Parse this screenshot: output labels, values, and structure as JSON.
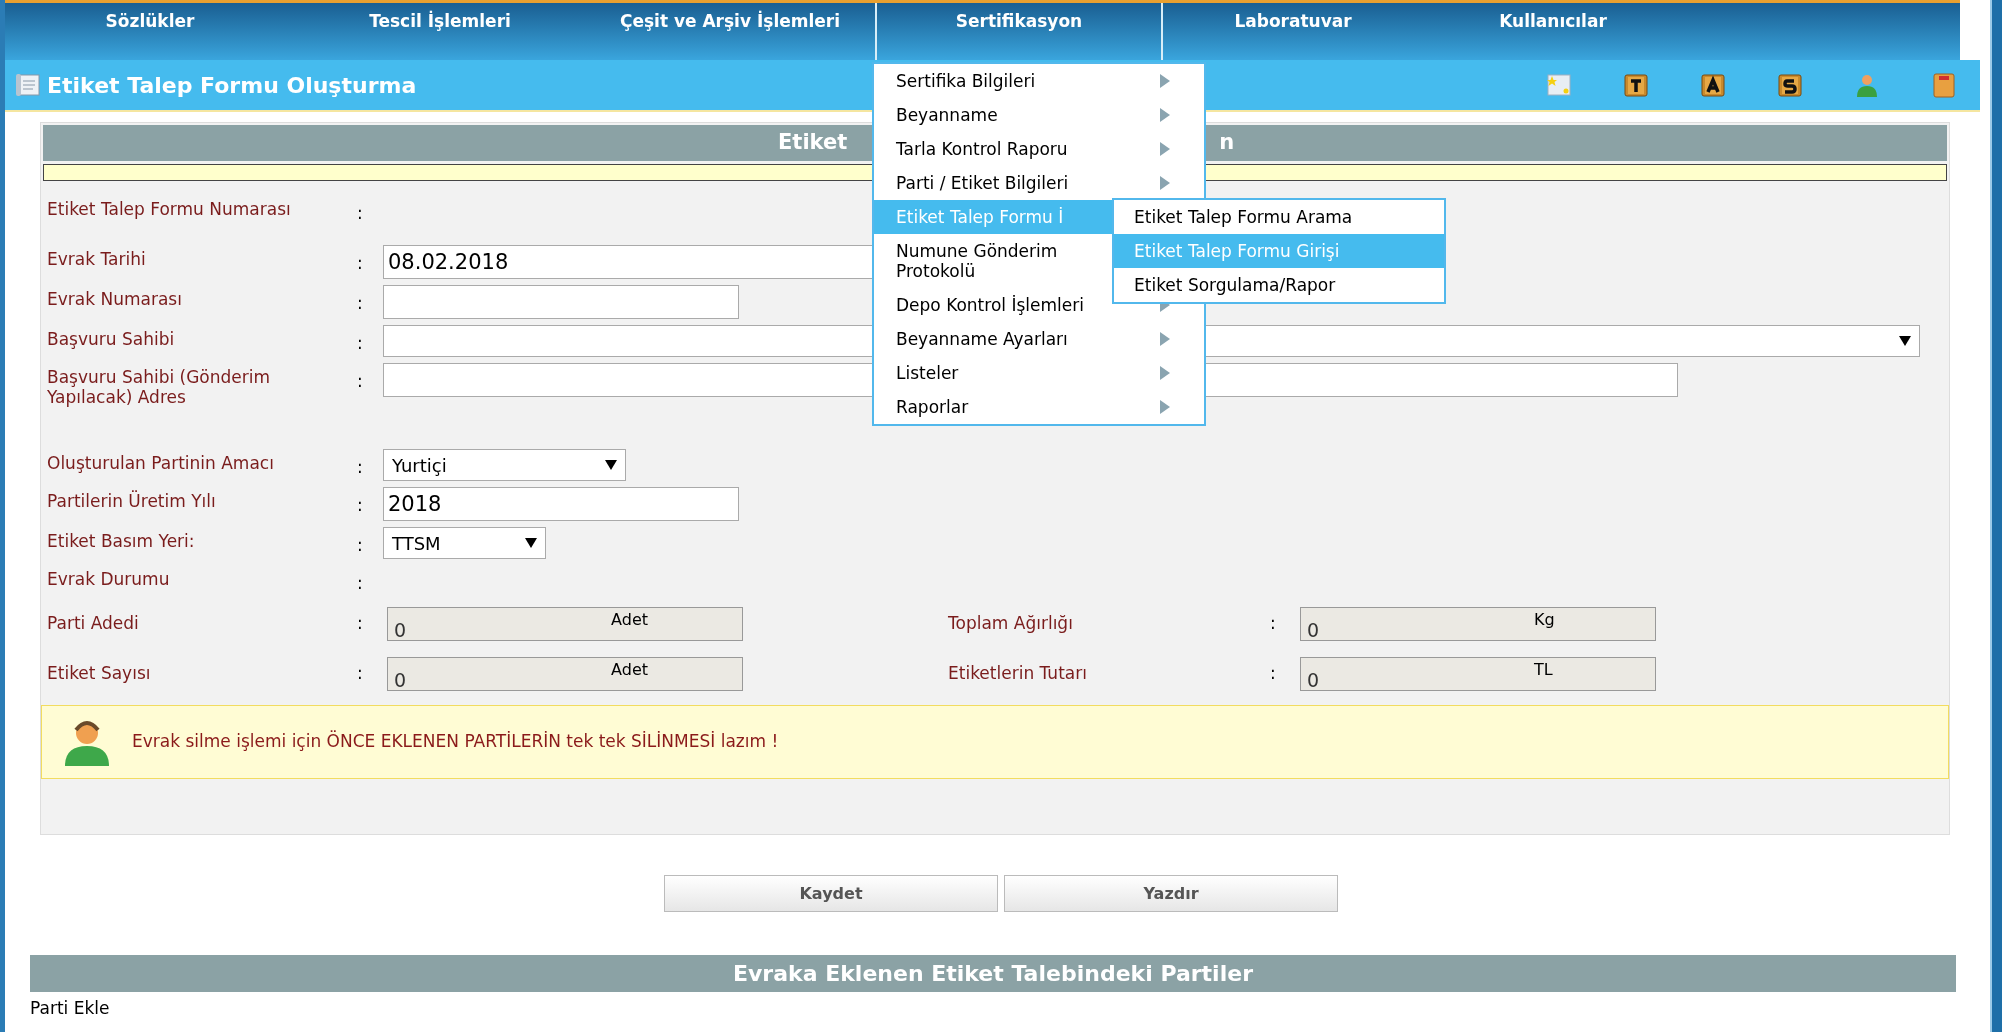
{
  "nav": [
    {
      "label": "Sözlükler",
      "selected": false
    },
    {
      "label": "Tescil İşlemleri",
      "selected": false
    },
    {
      "label": "Çeşit ve Arşiv İşlemleri",
      "selected": false
    },
    {
      "label": "Sertifikasyon",
      "selected": true
    },
    {
      "label": "Laboratuvar",
      "selected": false
    },
    {
      "label": "Kullanıcılar",
      "selected": false
    }
  ],
  "page_title": "Etiket Talep Formu Oluşturma",
  "form": {
    "header_parts": [
      "Etiket",
      "n"
    ],
    "rows": [
      {
        "kind": "none",
        "label": "Etiket Talep Formu Numarası",
        "separator": ":"
      },
      {
        "kind": "input",
        "label": "Evrak Tarihi",
        "separator": ":",
        "value": "08.02.2018"
      },
      {
        "kind": "input",
        "label": "Evrak Numarası",
        "separator": ":",
        "value": ""
      },
      {
        "kind": "select",
        "label": "Başvuru Sahibi",
        "separator": ":",
        "value": ""
      },
      {
        "kind": "input",
        "label": "Başvuru Sahibi (Gönderim Yapılacak) Adres",
        "separator": ":",
        "value": ""
      },
      {
        "kind": "select",
        "label": "Oluşturulan Partinin Amacı",
        "separator": ":",
        "value": "Yurtiçi"
      },
      {
        "kind": "input",
        "label": "Partilerin Üretim Yılı",
        "separator": ":",
        "value": "2018"
      },
      {
        "kind": "select",
        "label": "Etiket Basım Yeri:",
        "separator": ":",
        "value": "TTSM"
      },
      {
        "kind": "none",
        "label": "Evrak Durumu",
        "separator": ":"
      }
    ],
    "totals": [
      {
        "label": "Parti Adedi",
        "separator": ":",
        "value": "0",
        "unit": "Adet"
      },
      {
        "label": "Toplam Ağırlığı",
        "separator": ":",
        "value": "0",
        "unit": "Kg"
      },
      {
        "label": "Etiket Sayısı",
        "separator": ":",
        "value": "0",
        "unit": "Adet"
      },
      {
        "label": "Etiketlerin Tutarı",
        "separator": ":",
        "value": "0",
        "unit": "TL"
      }
    ],
    "warning": "Evrak silme işlemi için ÖNCE EKLENEN PARTİLERİN tek tek SİLİNMESİ lazım !"
  },
  "buttons": [
    "Kaydet",
    "Yazdır"
  ],
  "parties_header": "Evraka Eklenen Etiket Talebindeki Partiler",
  "add_party_link": "Parti Ekle",
  "menu": [
    {
      "label": "Sertifika Bilgileri",
      "selected": false,
      "arrow": true
    },
    {
      "label": "Beyanname",
      "selected": false,
      "arrow": true
    },
    {
      "label": "Tarla Kontrol Raporu",
      "selected": false,
      "arrow": true
    },
    {
      "label": "Parti / Etiket Bilgileri",
      "selected": false,
      "arrow": true
    },
    {
      "label": "Etiket Talep Formu İ",
      "selected": true
    },
    {
      "label": "Numune Gönderim Protokolü",
      "selected": false
    },
    {
      "label": "Depo Kontrol İşlemleri",
      "selected": false,
      "arrow": true
    },
    {
      "label": "Beyanname Ayarları",
      "selected": false,
      "arrow": true
    },
    {
      "label": "Listeler",
      "selected": false,
      "arrow": true
    },
    {
      "label": "Raporlar",
      "selected": false,
      "arrow": true
    }
  ],
  "submenu": [
    {
      "label": "Etiket Talep Formu Arama",
      "selected": false
    },
    {
      "label": "Etiket Talep Formu Girişi",
      "selected": true
    },
    {
      "label": "Etiket Sorgulama/Rapor",
      "selected": false
    }
  ]
}
